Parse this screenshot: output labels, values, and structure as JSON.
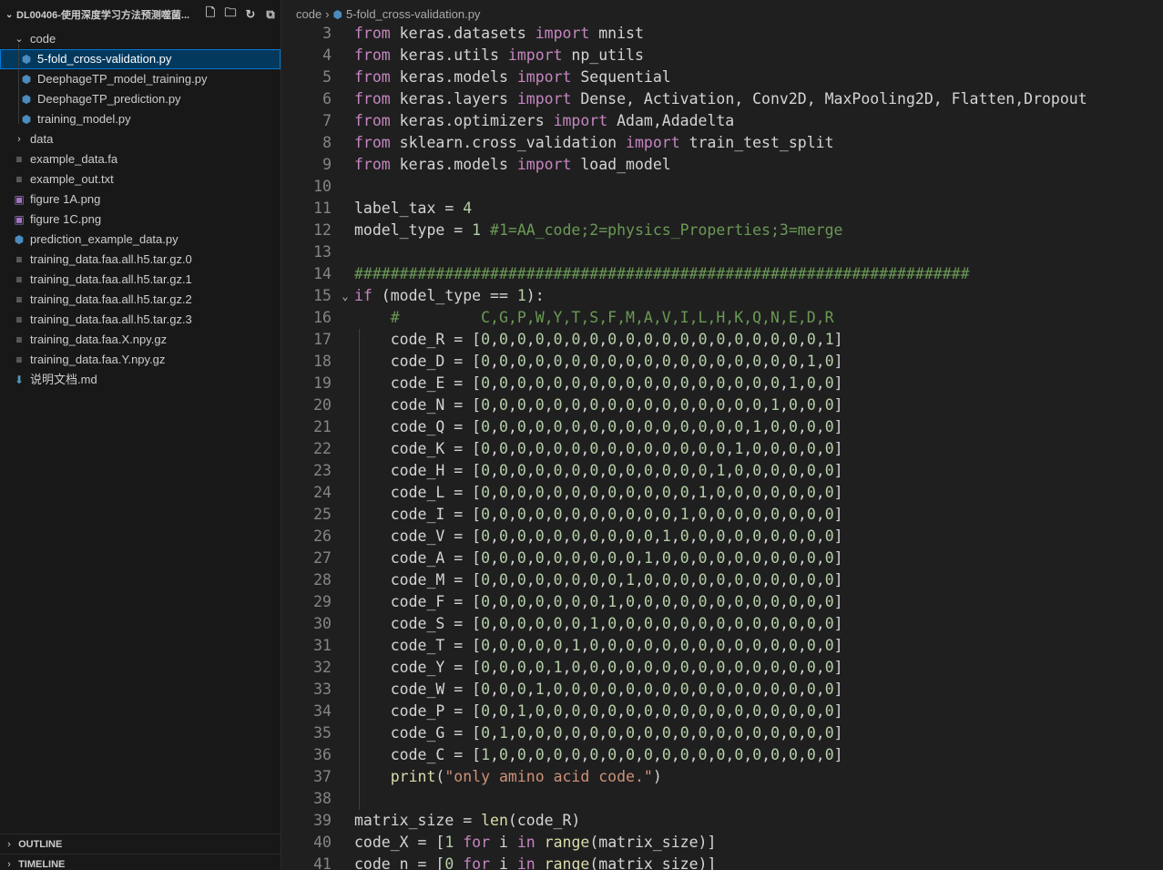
{
  "sidebar": {
    "header_title": "DL00406-使用深度学习方法预测噬菌...",
    "items": [
      {
        "label": "code",
        "type": "folder-open"
      },
      {
        "label": "5-fold_cross-validation.py",
        "type": "py",
        "selected": true
      },
      {
        "label": "DeephageTP_model_training.py",
        "type": "py"
      },
      {
        "label": "DeephageTP_prediction.py",
        "type": "py"
      },
      {
        "label": "training_model.py",
        "type": "py"
      },
      {
        "label": "data",
        "type": "folder-closed"
      },
      {
        "label": "example_data.fa",
        "type": "text"
      },
      {
        "label": "example_out.txt",
        "type": "text"
      },
      {
        "label": "figure 1A.png",
        "type": "image"
      },
      {
        "label": "figure 1C.png",
        "type": "image"
      },
      {
        "label": "prediction_example_data.py",
        "type": "py"
      },
      {
        "label": "training_data.faa.all.h5.tar.gz.0",
        "type": "text"
      },
      {
        "label": "training_data.faa.all.h5.tar.gz.1",
        "type": "text"
      },
      {
        "label": "training_data.faa.all.h5.tar.gz.2",
        "type": "text"
      },
      {
        "label": "training_data.faa.all.h5.tar.gz.3",
        "type": "text"
      },
      {
        "label": "training_data.faa.X.npy.gz",
        "type": "text"
      },
      {
        "label": "training_data.faa.Y.npy.gz",
        "type": "text"
      },
      {
        "label": "说明文档.md",
        "type": "markdown"
      }
    ],
    "outline_label": "OUTLINE",
    "timeline_label": "TIMELINE"
  },
  "editor": {
    "breadcrumb": {
      "folder": "code",
      "file": "5-fold_cross-validation.py"
    },
    "lines": [
      {
        "n": "3",
        "text": "from keras.datasets import mnist"
      },
      {
        "n": "4",
        "text": "from keras.utils import np_utils"
      },
      {
        "n": "5",
        "text": "from keras.models import Sequential"
      },
      {
        "n": "6",
        "text": "from keras.layers import Dense, Activation, Conv2D, MaxPooling2D, Flatten,Dropout"
      },
      {
        "n": "7",
        "text": "from keras.optimizers import Adam,Adadelta"
      },
      {
        "n": "8",
        "text": "from sklearn.cross_validation import train_test_split"
      },
      {
        "n": "9",
        "text": "from keras.models import load_model"
      },
      {
        "n": "10",
        "text": ""
      },
      {
        "n": "11",
        "text": "label_tax = 4"
      },
      {
        "n": "12",
        "text": "model_type = 1 #1=AA_code;2=physics_Properties;3=merge"
      },
      {
        "n": "13",
        "text": ""
      },
      {
        "n": "14",
        "text": "####################################################################"
      },
      {
        "n": "15",
        "text": "if (model_type == 1):"
      },
      {
        "n": "16",
        "text": "    #         C,G,P,W,Y,T,S,F,M,A,V,I,L,H,K,Q,N,E,D,R"
      },
      {
        "n": "17",
        "text": "    code_R = [0,0,0,0,0,0,0,0,0,0,0,0,0,0,0,0,0,0,0,1]"
      },
      {
        "n": "18",
        "text": "    code_D = [0,0,0,0,0,0,0,0,0,0,0,0,0,0,0,0,0,0,1,0]"
      },
      {
        "n": "19",
        "text": "    code_E = [0,0,0,0,0,0,0,0,0,0,0,0,0,0,0,0,0,1,0,0]"
      },
      {
        "n": "20",
        "text": "    code_N = [0,0,0,0,0,0,0,0,0,0,0,0,0,0,0,0,1,0,0,0]"
      },
      {
        "n": "21",
        "text": "    code_Q = [0,0,0,0,0,0,0,0,0,0,0,0,0,0,0,1,0,0,0,0]"
      },
      {
        "n": "22",
        "text": "    code_K = [0,0,0,0,0,0,0,0,0,0,0,0,0,0,1,0,0,0,0,0]"
      },
      {
        "n": "23",
        "text": "    code_H = [0,0,0,0,0,0,0,0,0,0,0,0,0,1,0,0,0,0,0,0]"
      },
      {
        "n": "24",
        "text": "    code_L = [0,0,0,0,0,0,0,0,0,0,0,0,1,0,0,0,0,0,0,0]"
      },
      {
        "n": "25",
        "text": "    code_I = [0,0,0,0,0,0,0,0,0,0,0,1,0,0,0,0,0,0,0,0]"
      },
      {
        "n": "26",
        "text": "    code_V = [0,0,0,0,0,0,0,0,0,0,1,0,0,0,0,0,0,0,0,0]"
      },
      {
        "n": "27",
        "text": "    code_A = [0,0,0,0,0,0,0,0,0,1,0,0,0,0,0,0,0,0,0,0]"
      },
      {
        "n": "28",
        "text": "    code_M = [0,0,0,0,0,0,0,0,1,0,0,0,0,0,0,0,0,0,0,0]"
      },
      {
        "n": "29",
        "text": "    code_F = [0,0,0,0,0,0,0,1,0,0,0,0,0,0,0,0,0,0,0,0]"
      },
      {
        "n": "30",
        "text": "    code_S = [0,0,0,0,0,0,1,0,0,0,0,0,0,0,0,0,0,0,0,0]"
      },
      {
        "n": "31",
        "text": "    code_T = [0,0,0,0,0,1,0,0,0,0,0,0,0,0,0,0,0,0,0,0]"
      },
      {
        "n": "32",
        "text": "    code_Y = [0,0,0,0,1,0,0,0,0,0,0,0,0,0,0,0,0,0,0,0]"
      },
      {
        "n": "33",
        "text": "    code_W = [0,0,0,1,0,0,0,0,0,0,0,0,0,0,0,0,0,0,0,0]"
      },
      {
        "n": "34",
        "text": "    code_P = [0,0,1,0,0,0,0,0,0,0,0,0,0,0,0,0,0,0,0,0]"
      },
      {
        "n": "35",
        "text": "    code_G = [0,1,0,0,0,0,0,0,0,0,0,0,0,0,0,0,0,0,0,0]"
      },
      {
        "n": "36",
        "text": "    code_C = [1,0,0,0,0,0,0,0,0,0,0,0,0,0,0,0,0,0,0,0]"
      },
      {
        "n": "37",
        "text": "    print(\"only amino acid code.\")"
      },
      {
        "n": "38",
        "text": ""
      },
      {
        "n": "39",
        "text": "matrix_size = len(code_R)"
      },
      {
        "n": "40",
        "text": "code_X = [1 for i in range(matrix_size)]"
      },
      {
        "n": "41",
        "text": "code_n = [0 for i in range(matrix_size)]"
      }
    ]
  },
  "theme": {
    "editor_bg": "#1f1f1f",
    "sidebar_bg": "#181818",
    "selection_bg": "#04395e",
    "focus_border": "#0078d4",
    "keyword": "#c586c0",
    "comment": "#6a9955",
    "number": "#b5cea8",
    "string": "#ce9178"
  }
}
